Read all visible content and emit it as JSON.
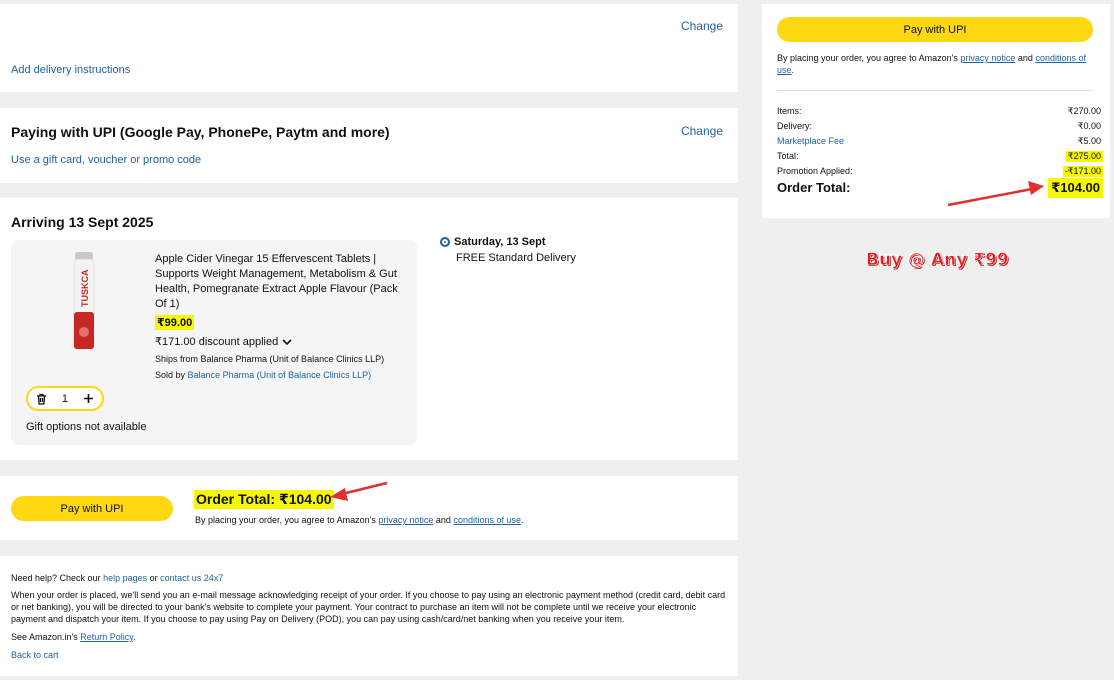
{
  "address": {
    "change": "Change",
    "add_instructions": "Add delivery instructions"
  },
  "payment": {
    "title": "Paying with UPI (Google Pay, PhonePe, Paytm and more)",
    "change": "Change",
    "gift_link": "Use a gift card, voucher or promo code"
  },
  "arriving": {
    "title": "Arriving 13 Sept 2025",
    "item": {
      "brand_on_image": "TUSKCA",
      "title": "Apple Cider Vinegar 15 Effervescent Tablets | Supports Weight Management, Metabolism & Gut Health, Pomegranate Extract Apple Flavour (Pack Of 1)",
      "price": "₹99.00",
      "discount": "₹171.00 discount applied",
      "ships_from": "Ships from Balance Pharma (Unit of Balance Clinics LLP)",
      "sold_by_label": "Sold by",
      "sold_by": "Balance Pharma (Unit of Balance Clinics LLP)",
      "quantity": "1",
      "gift_options": "Gift options not available"
    },
    "delivery": {
      "date": "Saturday, 13 Sept",
      "type": "FREE Standard Delivery"
    }
  },
  "order_bottom": {
    "button": "Pay with UPI",
    "total": "Order Total: ₹104.00",
    "agree_prefix": "By placing your order, you agree to Amazon's",
    "privacy": "privacy notice",
    "and": "and",
    "conditions": "conditions of use",
    "period": "."
  },
  "help": {
    "need_help": "Need help? Check our",
    "help_pages": "help pages",
    "or": "or",
    "contact": "contact us 24x7",
    "paragraph": "When your order is placed, we'll send you an e-mail message acknowledging receipt of your order. If you choose to pay using an electronic payment method (credit card, debit card or net banking), you will be directed to your bank's website to complete your payment. Your contract to purchase an item will not be complete until we receive your electronic payment and dispatch your item. If you choose to pay using Pay on Delivery (POD), you can pay using cash/card/net banking when you receive your item.",
    "see": "See Amazon.in's",
    "return_policy": "Return Policy",
    "period": ".",
    "back": "Back to cart"
  },
  "summary": {
    "button": "Pay with UPI",
    "agree_prefix": "By placing your order, you agree to Amazon's",
    "privacy": "privacy notice",
    "and": "and",
    "conditions": "conditions of use",
    "period": ".",
    "rows": [
      {
        "label": "Items:",
        "value": "₹270.00"
      },
      {
        "label": "Delivery:",
        "value": "₹0.00"
      },
      {
        "label": "Marketplace Fee",
        "value": "₹5.00"
      },
      {
        "label": "Total:",
        "value": "₹275.00"
      },
      {
        "label": "Promotion Applied:",
        "value": "-₹171.00"
      }
    ],
    "order_total_label": "Order Total:",
    "order_total_value": "₹104.00"
  },
  "annotation": {
    "promo_text": "Buy @ Any ₹99"
  },
  "colors": {
    "highlight": "#f7f700",
    "button": "#ffd814",
    "link": "#2162a1",
    "arrow": "#e03030"
  }
}
